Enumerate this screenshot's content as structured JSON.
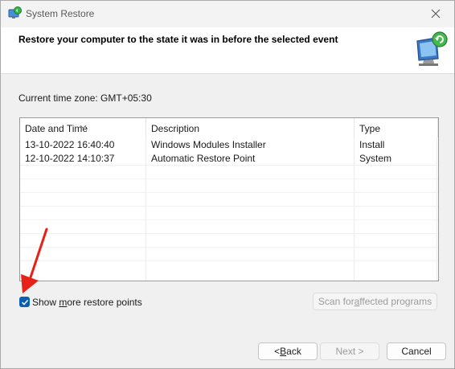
{
  "window": {
    "title": "System Restore"
  },
  "header": {
    "title": "Restore your computer to the state it was in before the selected event"
  },
  "timezone": "Current time zone: GMT+05:30",
  "table": {
    "columns": [
      "Date and Time",
      "Description",
      "Type"
    ],
    "rows": [
      [
        "13-10-2022 16:40:40",
        "Windows Modules Installer",
        "Install"
      ],
      [
        "12-10-2022 14:10:37",
        "Automatic Restore Point",
        "System"
      ]
    ]
  },
  "show_more": {
    "label_pre": "Show ",
    "label_u": "m",
    "label_post": "ore restore points",
    "checked": true
  },
  "buttons": {
    "scan_pre": "Scan for ",
    "scan_u": "a",
    "scan_post": "ffected programs",
    "back_pre": "< ",
    "back_u": "B",
    "back_post": "ack",
    "next": "Next >",
    "cancel": "Cancel"
  },
  "icons": [
    "system-restore-icon",
    "close-icon",
    "restore-monitor-icon",
    "check-icon",
    "sort-arrow-icon",
    "red-arrow-annotation"
  ],
  "colors": {
    "accent": "#0a5fb4",
    "annotation": "#e8201a"
  }
}
